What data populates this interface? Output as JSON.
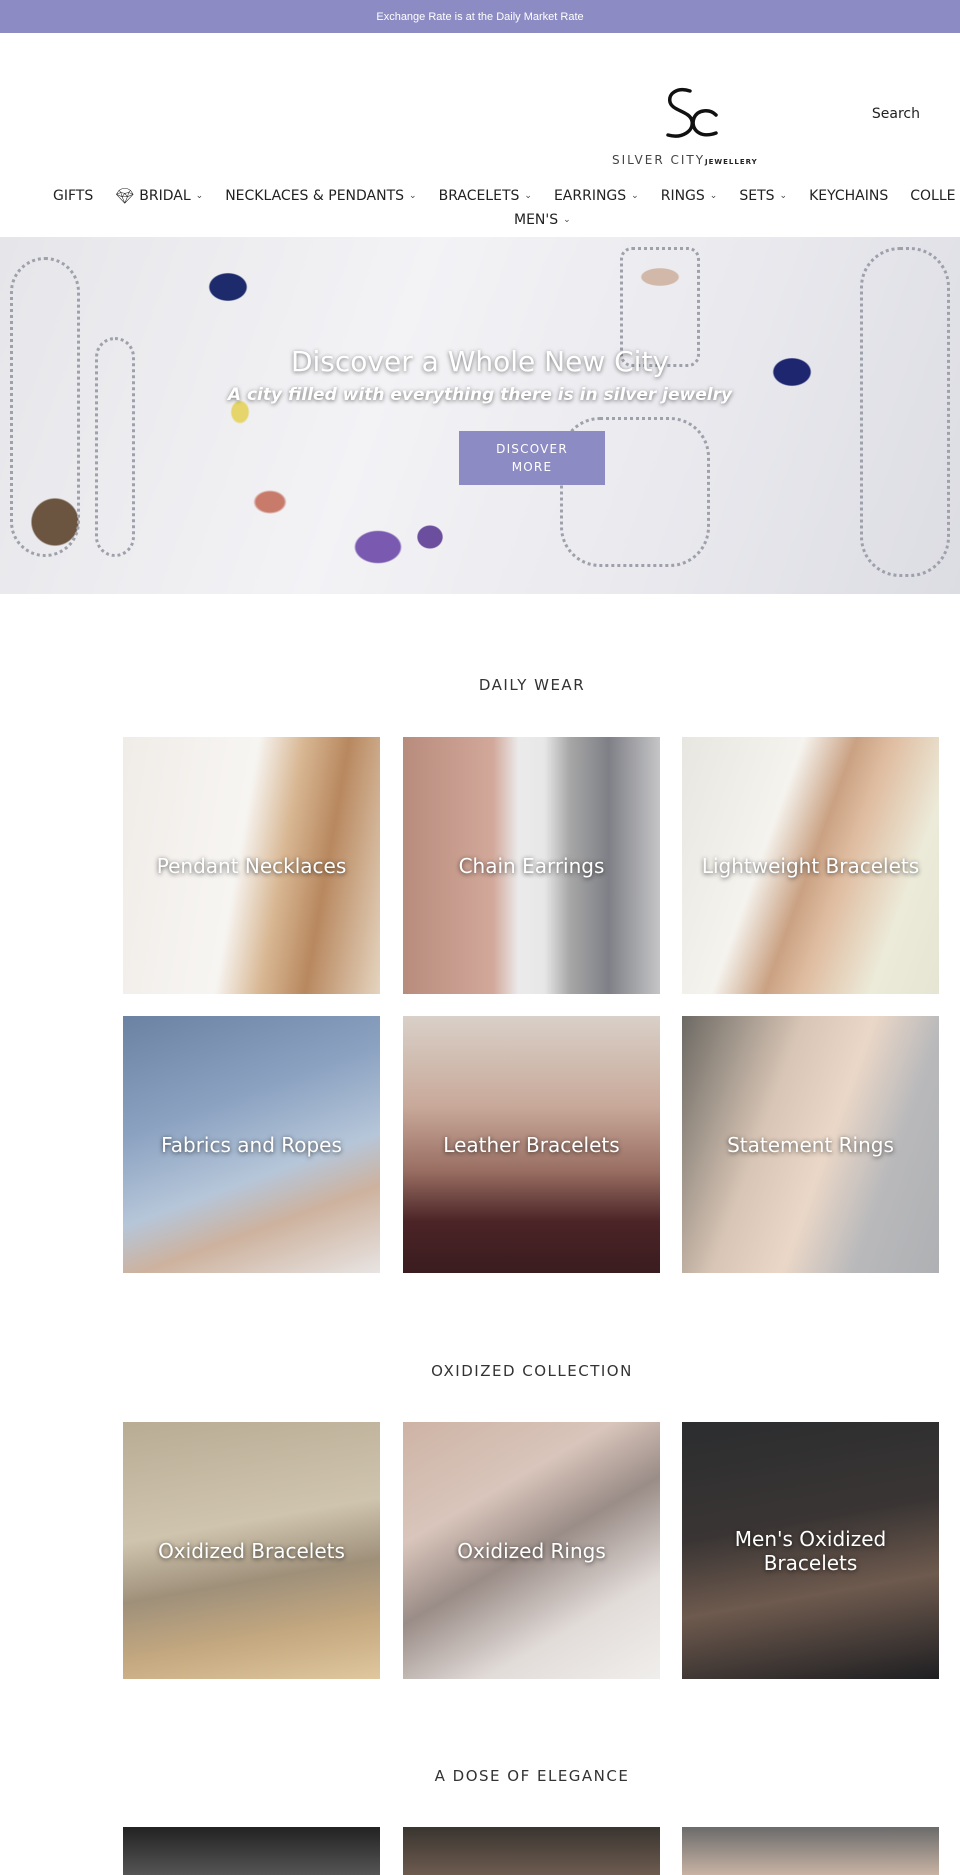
{
  "announcement": {
    "text": "Exchange Rate is at the Daily Market Rate"
  },
  "header": {
    "logo_brand": "SILVER CITY",
    "logo_sub": "JEWELLERY",
    "search_label": "Search"
  },
  "nav": {
    "items": [
      {
        "label": "GIFTS",
        "dropdown": false
      },
      {
        "label": "BRIDAL",
        "dropdown": true
      },
      {
        "label": "NECKLACES & PENDANTS",
        "dropdown": true
      },
      {
        "label": "BRACELETS",
        "dropdown": true
      },
      {
        "label": "EARRINGS",
        "dropdown": true
      },
      {
        "label": "RINGS",
        "dropdown": true
      },
      {
        "label": "SETS",
        "dropdown": true
      },
      {
        "label": "KEYCHAINS",
        "dropdown": false
      },
      {
        "label": "COLLE",
        "dropdown": false
      },
      {
        "label": "MEN'S",
        "dropdown": true
      }
    ]
  },
  "hero": {
    "title": "Discover a Whole New City",
    "subtitle": "A city filled with everything there is in silver jewelry",
    "button_line1": "DISCOVER",
    "button_line2": "MORE"
  },
  "sections": [
    {
      "title": "DAILY WEAR",
      "tiles": [
        "Pendant Necklaces",
        "Chain Earrings",
        "Lightweight Bracelets",
        "Fabrics and Ropes",
        "Leather Bracelets",
        "Statement Rings"
      ]
    },
    {
      "title": "OXIDIZED COLLECTION",
      "tiles": [
        "Oxidized Bracelets",
        "Oxidized Rings",
        "Men's Oxidized Bracelets"
      ]
    },
    {
      "title": "A DOSE OF ELEGANCE",
      "tiles": [
        "",
        "",
        ""
      ]
    }
  ],
  "colors": {
    "accent": "#8d8bc4",
    "text": "#222222"
  }
}
